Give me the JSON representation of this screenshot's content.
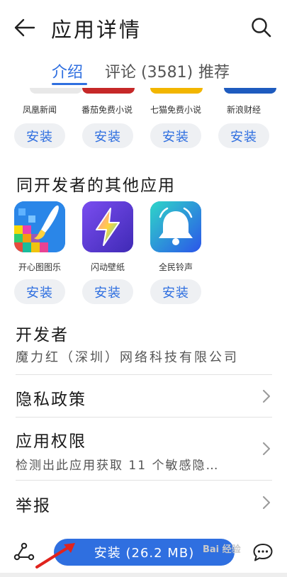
{
  "header": {
    "title": "应用详情",
    "back_icon": "arrow-left-icon",
    "search_icon": "search-icon"
  },
  "tabs": [
    {
      "label": "介绍",
      "active": true
    },
    {
      "label": "评论 (3581)",
      "active": false
    },
    {
      "label": "推荐",
      "active": false
    }
  ],
  "recommended_apps": [
    {
      "name": "凤凰新闻",
      "install_label": "安装",
      "strip_color": "#e8e8e8"
    },
    {
      "name": "番茄免费小说",
      "install_label": "安装",
      "strip_color": "#c62828"
    },
    {
      "name": "七猫免费小说",
      "install_label": "安装",
      "strip_color": "#f2b600"
    },
    {
      "name": "新浪财经",
      "install_label": "安装",
      "strip_color": "#1e5bbf"
    }
  ],
  "other_apps_section": {
    "title": "同开发者的其他应用",
    "apps": [
      {
        "name": "开心图图乐",
        "install_label": "安装",
        "icon": "paintbrush-mosaic-icon"
      },
      {
        "name": "闪动壁纸",
        "install_label": "安装",
        "icon": "lightning-bolt-icon"
      },
      {
        "name": "全民铃声",
        "install_label": "安装",
        "icon": "bell-icon"
      }
    ]
  },
  "developer": {
    "label": "开发者",
    "name": "魔力红（深圳）网络科技有限公司"
  },
  "privacy": {
    "label": "隐私政策"
  },
  "permissions": {
    "label": "应用权限",
    "summary": "检测出此应用获取 11 个敏感隐…"
  },
  "report": {
    "label": "举报"
  },
  "bottom_bar": {
    "install_label": "安装 (26.2 MB)",
    "share_icon": "share-icon",
    "comment_icon": "comment-icon",
    "watermark": "Bai 经验"
  },
  "colors": {
    "accent": "#2f6fe0",
    "install_bg": "#eef0f3"
  }
}
